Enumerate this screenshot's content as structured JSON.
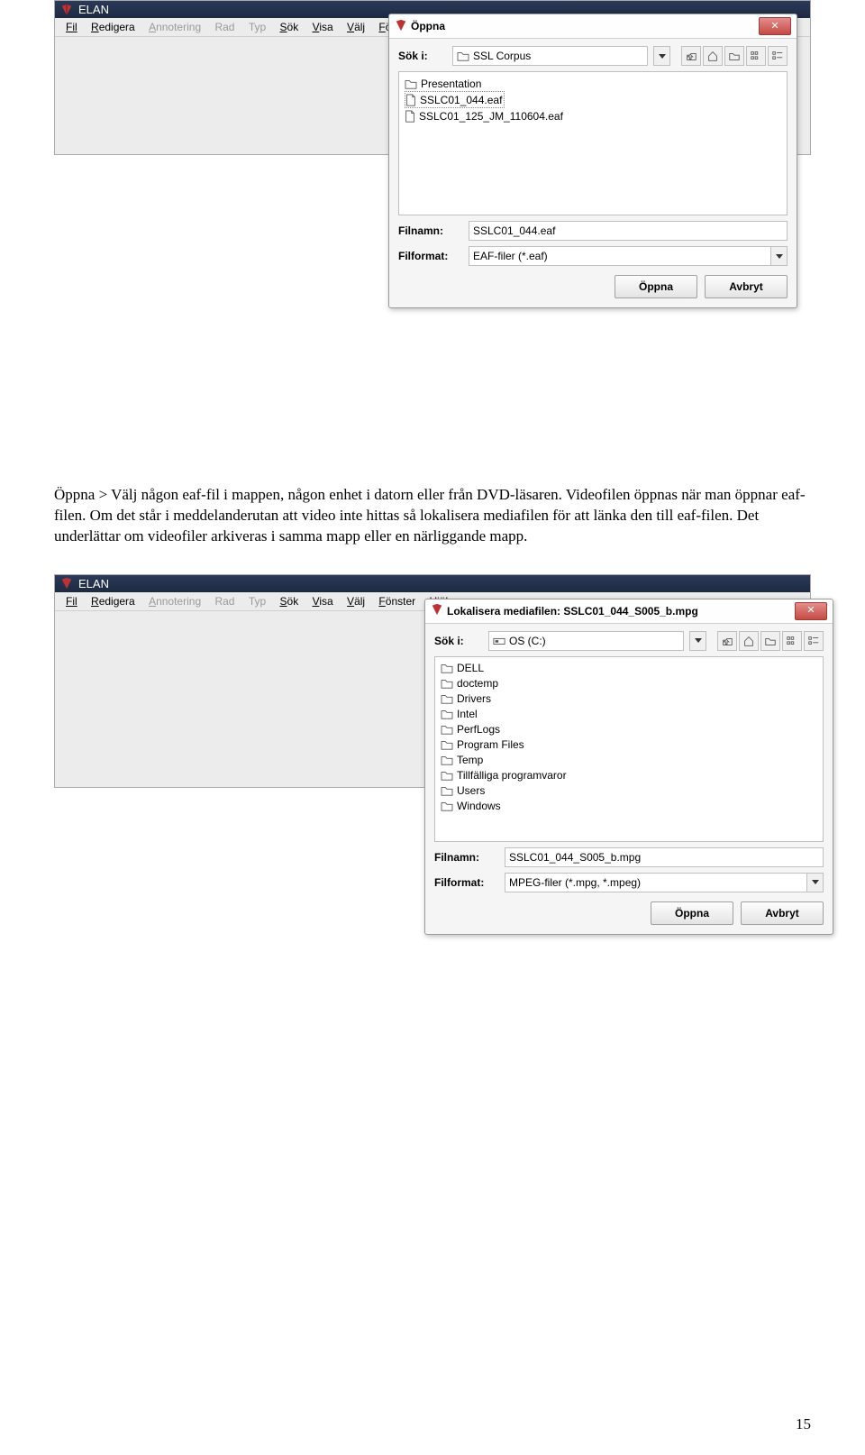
{
  "app_title": "ELAN",
  "menus": {
    "fil": "Fil",
    "redigera": "Redigera",
    "annotering": "Annotering",
    "rad": "Rad",
    "typ": "Typ",
    "sok": "Sök",
    "visa": "Visa",
    "valj": "Välj",
    "fonster": "Fönster",
    "hjalp": "Hjälp"
  },
  "dialog1": {
    "title": "Öppna",
    "lookin_label": "Sök i:",
    "lookin_value": "SSL Corpus",
    "files": {
      "folder1": "Presentation",
      "file1": "SSLC01_044.eaf",
      "file2": "SSLC01_125_JM_110604.eaf"
    },
    "filename_label": "Filnamn:",
    "filename_value": "SSLC01_044.eaf",
    "format_label": "Filformat:",
    "format_value": "EAF-filer (*.eaf)",
    "open_btn": "Öppna",
    "cancel_btn": "Avbryt"
  },
  "paragraph": "Öppna > Välj någon eaf-fil i mappen, någon enhet i datorn eller från DVD-läsaren. Videofilen öppnas när man öppnar eaf-filen. Om det står i meddelanderutan att video inte hittas så lokalisera mediafilen för att länka den till eaf-filen. Det underlättar om videofiler arkiveras i samma mapp eller en närliggande mapp.",
  "dialog2": {
    "title": "Lokalisera mediafilen: SSLC01_044_S005_b.mpg",
    "lookin_label": "Sök i:",
    "lookin_value": "OS (C:)",
    "files": {
      "f1": "DELL",
      "f2": "doctemp",
      "f3": "Drivers",
      "f4": "Intel",
      "f5": "PerfLogs",
      "f6": "Program Files",
      "f7": "Temp",
      "f8": "Tillfälliga programvaror",
      "f9": "Users",
      "f10": "Windows"
    },
    "filename_label": "Filnamn:",
    "filename_value": "SSLC01_044_S005_b.mpg",
    "format_label": "Filformat:",
    "format_value": "MPEG-filer (*.mpg, *.mpeg)",
    "open_btn": "Öppna",
    "cancel_btn": "Avbryt"
  },
  "page_number": "15"
}
